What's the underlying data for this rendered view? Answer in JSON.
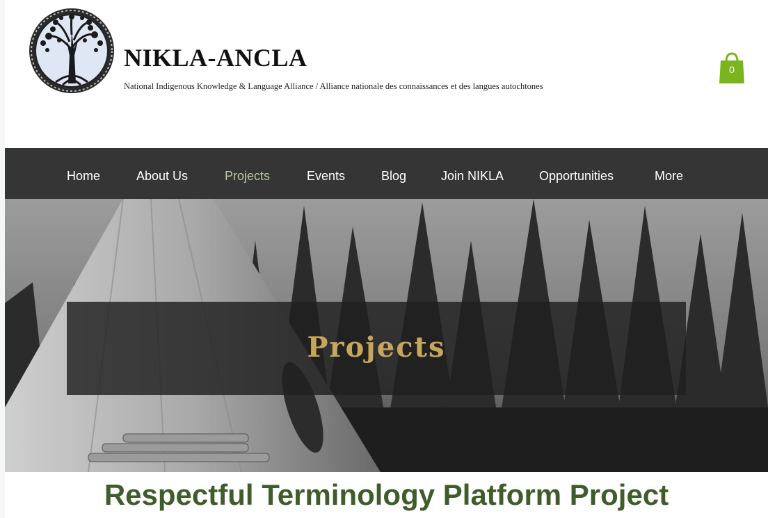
{
  "header": {
    "title": "NIKLA-ANCLA",
    "tagline": "National Indigenous Knowledge & Language Alliance / Alliance nationale des connaissances et des langues autochtones",
    "cart_count": "0",
    "cart_icon": "shopping-bag-icon",
    "accent_color": "#7ab51d"
  },
  "nav": {
    "items": [
      {
        "label": "Home"
      },
      {
        "label": "About Us"
      },
      {
        "label": "Projects",
        "active": true
      },
      {
        "label": "Events"
      },
      {
        "label": "Blog"
      },
      {
        "label": "Join NIKLA"
      },
      {
        "label": "Opportunities"
      },
      {
        "label": "More"
      }
    ],
    "active_color": "#b6c99b"
  },
  "hero": {
    "title": "Projects",
    "title_color": "#c8a55c"
  },
  "main": {
    "heading": "Respectful Terminology Platform Project",
    "heading_color": "#3e5d2a"
  }
}
